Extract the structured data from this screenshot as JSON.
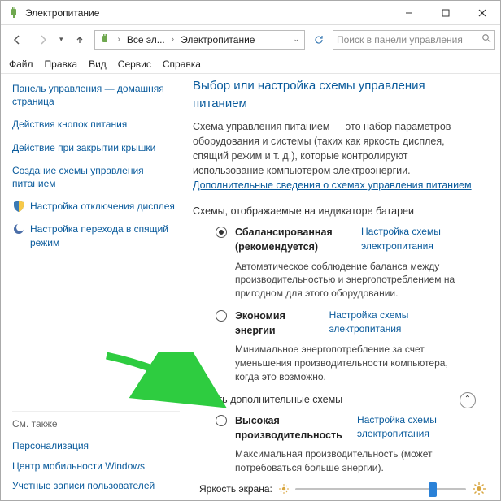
{
  "window": {
    "title": "Электропитание"
  },
  "breadcrumb": {
    "root": "Все эл...",
    "here": "Электропитание"
  },
  "search": {
    "placeholder": "Поиск в панели управления"
  },
  "menu": {
    "file": "Файл",
    "edit": "Правка",
    "view": "Вид",
    "service": "Сервис",
    "help": "Справка"
  },
  "sidebar": {
    "home": "Панель управления — домашняя страница",
    "buttons": "Действия кнопок питания",
    "lid": "Действие при закрытии крышки",
    "create": "Создание схемы управления питанием",
    "display": "Настройка отключения дисплея",
    "sleep": "Настройка перехода в спящий режим",
    "seealso": "См. также",
    "pers": "Персонализация",
    "mobility": "Центр мобильности Windows",
    "accounts": "Учетные записи пользователей"
  },
  "main": {
    "h1": "Выбор или настройка схемы управления питанием",
    "desc_a": "Схема управления питанием — это набор параметров оборудования и системы (таких как яркость дисплея, спящий режим и т. д.), которые контролируют использование компьютером электроэнергии. ",
    "desc_link": "Дополнительные сведения о схемах управления питанием",
    "batt_label": "Схемы, отображаемые на индикаторе батареи",
    "plan_link": "Настройка схемы электропитания",
    "collapse": "Скрыть дополнительные схемы",
    "plans": {
      "balanced": {
        "name": "Сбалансированная (рекомендуется)",
        "desc": "Автоматическое соблюдение баланса между производительностью и энергопотреблением на пригодном для этого оборудовании."
      },
      "saver": {
        "name": "Экономия энергии",
        "desc": "Минимальное энергопотребление за счет уменьшения производительности компьютера, когда это возможно."
      },
      "high": {
        "name": "Высокая производительность",
        "desc": "Максимальная производительность (может потребоваться больше энергии)."
      }
    }
  },
  "brightness": {
    "label": "Яркость экрана:"
  }
}
